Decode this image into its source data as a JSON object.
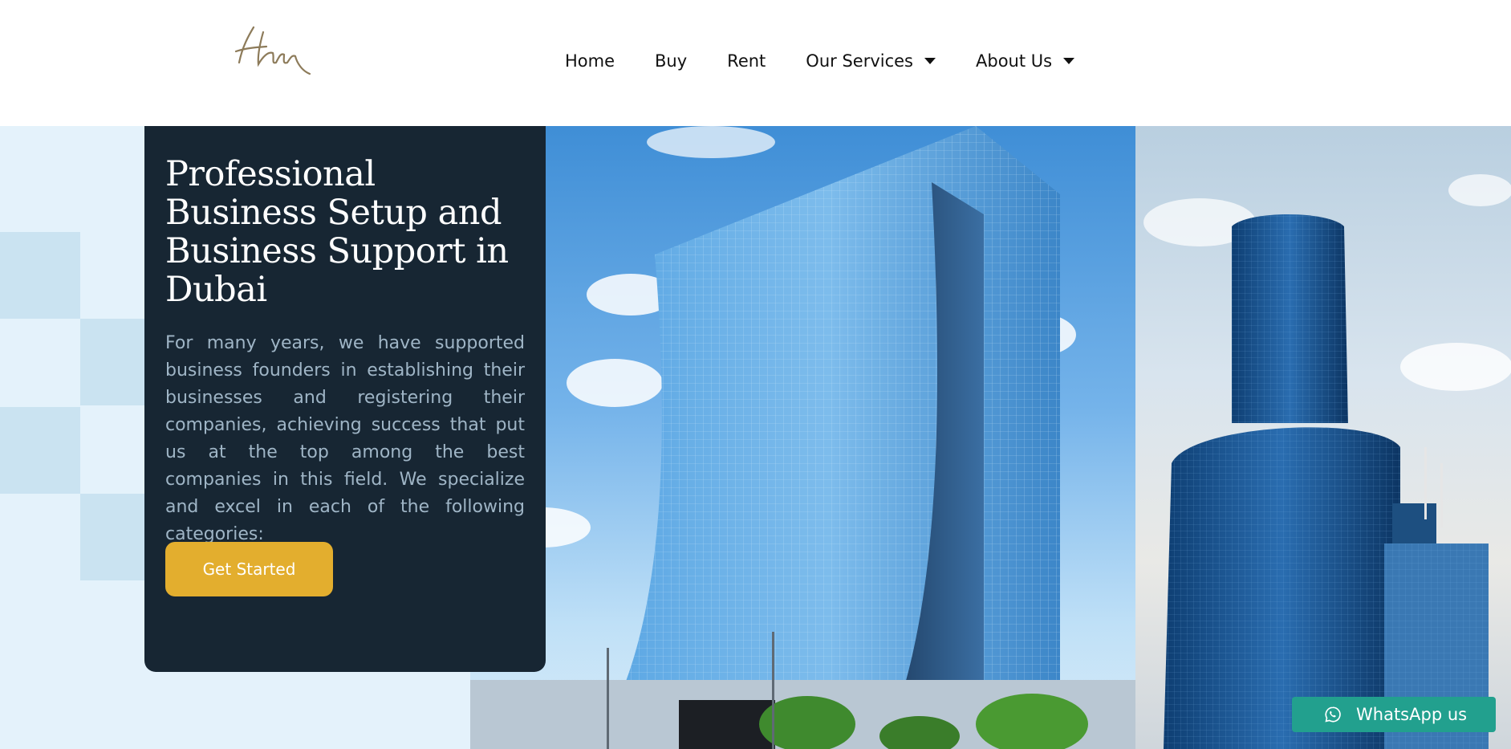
{
  "brand": {
    "logo_text": "Htin"
  },
  "nav": {
    "items": [
      {
        "label": "Home",
        "has_dropdown": false
      },
      {
        "label": "Buy",
        "has_dropdown": false
      },
      {
        "label": "Rent",
        "has_dropdown": false
      },
      {
        "label": "Our Services",
        "has_dropdown": true
      },
      {
        "label": "About Us",
        "has_dropdown": true
      }
    ]
  },
  "hero": {
    "title": "Professional Business Setup and Business Support in Dubai",
    "text": "For many years, we have supported business founders in establishing their businesses and registering their companies, achieving success that put us at the top among the best companies in this field. We specialize and excel in each of the following categories:",
    "cta_label": "Get Started",
    "card_color": "#172633",
    "cta_color": "#e3ae2e"
  },
  "whatsapp": {
    "label": "WhatsApp us",
    "color": "#22a08e",
    "icon": "whatsapp-icon"
  }
}
